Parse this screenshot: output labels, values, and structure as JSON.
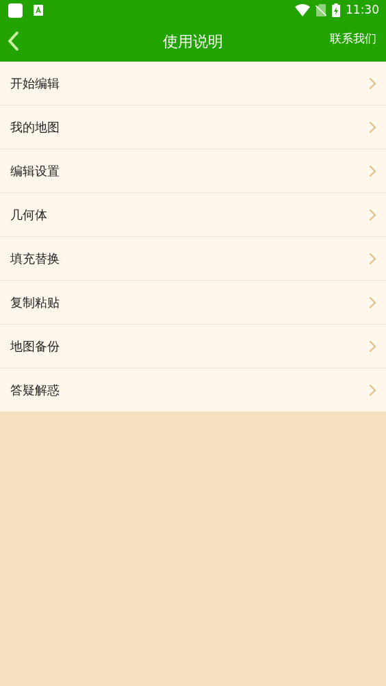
{
  "status_bar": {
    "time": "11:30"
  },
  "header": {
    "title": "使用说明",
    "action": "联系我们"
  },
  "items": [
    {
      "label": "开始编辑"
    },
    {
      "label": "我的地图"
    },
    {
      "label": "编辑设置"
    },
    {
      "label": "几何体"
    },
    {
      "label": "填充替换"
    },
    {
      "label": "复制粘贴"
    },
    {
      "label": "地图备份"
    },
    {
      "label": "答疑解惑"
    }
  ]
}
